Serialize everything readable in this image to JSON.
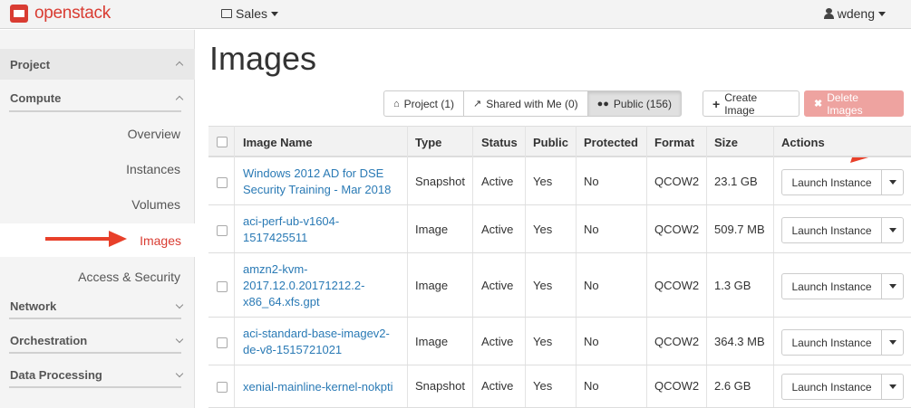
{
  "topbar": {
    "brand": "openstack",
    "project": "Sales",
    "user": "wdeng"
  },
  "sidebar": {
    "project_label": "Project",
    "compute_label": "Compute",
    "items": [
      {
        "label": "Overview"
      },
      {
        "label": "Instances"
      },
      {
        "label": "Volumes"
      },
      {
        "label": "Images"
      },
      {
        "label": "Access & Security"
      }
    ],
    "network_label": "Network",
    "orchestration_label": "Orchestration",
    "data_processing_label": "Data Processing"
  },
  "page": {
    "title": "Images"
  },
  "filters": {
    "project": "Project (1)",
    "shared": "Shared with Me (0)",
    "public": "Public (156)"
  },
  "actions": {
    "create": "Create Image",
    "delete": "Delete Images"
  },
  "table": {
    "headers": [
      "Image Name",
      "Type",
      "Status",
      "Public",
      "Protected",
      "Format",
      "Size",
      "Actions"
    ],
    "rows": [
      {
        "name": "Windows 2012 AD for DSE Security Training - Mar 2018",
        "name_lines": [
          "Windows 2012 AD for DSE",
          "Security Training - Mar 2018"
        ],
        "type": "Snapshot",
        "status": "Active",
        "public": "Yes",
        "protected": "No",
        "format": "QCOW2",
        "size": "23.1 GB",
        "action": "Launch Instance"
      },
      {
        "name": "aci-perf-ub-v1604-1517425511",
        "name_lines": [
          "aci-perf-ub-v1604-",
          "1517425511"
        ],
        "type": "Image",
        "status": "Active",
        "public": "Yes",
        "protected": "No",
        "format": "QCOW2",
        "size": "509.7 MB",
        "action": "Launch Instance"
      },
      {
        "name": "amzn2-kvm-2017.12.0.20171212.2-x86_64.xfs.gpt",
        "name_lines": [
          "amzn2-kvm-",
          "2017.12.0.20171212.2-",
          "x86_64.xfs.gpt"
        ],
        "type": "Image",
        "status": "Active",
        "public": "Yes",
        "protected": "No",
        "format": "QCOW2",
        "size": "1.3 GB",
        "action": "Launch Instance"
      },
      {
        "name": "aci-standard-base-imagev2-de-v8-1515721021",
        "name_lines": [
          "aci-standard-base-imagev2-",
          "de-v8-1515721021"
        ],
        "type": "Image",
        "status": "Active",
        "public": "Yes",
        "protected": "No",
        "format": "QCOW2",
        "size": "364.3 MB",
        "action": "Launch Instance"
      },
      {
        "name": "xenial-mainline-kernel-nokpti",
        "name_lines": [
          "xenial-mainline-kernel-nokpti"
        ],
        "type": "Snapshot",
        "status": "Active",
        "public": "Yes",
        "protected": "No",
        "format": "QCOW2",
        "size": "2.6 GB",
        "action": "Launch Instance"
      }
    ]
  },
  "colors": {
    "brand": "#d93c32",
    "link": "#2a7ab5",
    "annotation_arrow": "#e8402a",
    "delete_button": "#eea3a0"
  }
}
